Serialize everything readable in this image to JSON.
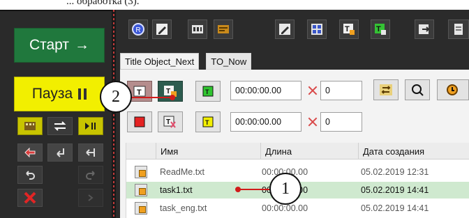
{
  "caption_fragment": "... обработка (3).",
  "left_panel": {
    "start_label": "Старт",
    "start_arrow": "→",
    "pause_label": "Пауза"
  },
  "tabs": [
    "Title Object_Next",
    "TO_Now"
  ],
  "controls": {
    "row1": {
      "timecode": "00:00:00.00",
      "count": "0"
    },
    "row2": {
      "timecode": "00:00:00.00",
      "count": "0"
    }
  },
  "table": {
    "columns": [
      "Имя",
      "Длина",
      "Дата создания"
    ],
    "rows": [
      {
        "name": "ReadMe.txt",
        "length": "00:00:00.00",
        "date": "05.02.2019 12:31"
      },
      {
        "name": "task1.txt",
        "length": "00:00:00.00",
        "date": "05.02.2019 14:41",
        "selected": true
      },
      {
        "name": "task_eng.txt",
        "length": "00:00:00.00",
        "date": "05.02.2019 14:41"
      }
    ]
  },
  "callouts": [
    "1",
    "2"
  ]
}
